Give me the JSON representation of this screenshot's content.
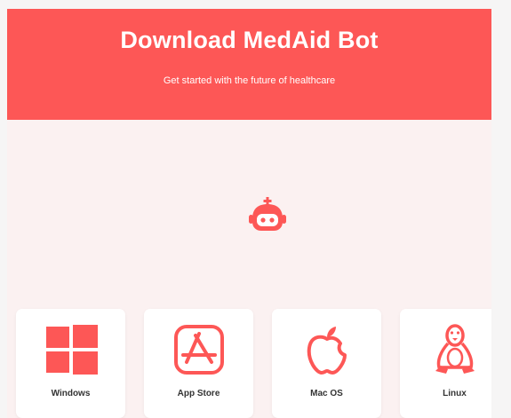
{
  "header": {
    "title": "Download MedAid Bot",
    "subtitle": "Get started with the future of healthcare"
  },
  "logo": {
    "icon": "medical-bot-icon"
  },
  "platforms": [
    {
      "label": "Windows",
      "icon": "windows-icon"
    },
    {
      "label": "App Store",
      "icon": "app-store-icon"
    },
    {
      "label": "Mac OS",
      "icon": "apple-icon"
    },
    {
      "label": "Linux",
      "icon": "linux-icon"
    }
  ],
  "colors": {
    "brand": "#fd5756",
    "background": "#fbf1f1",
    "card": "#ffffff"
  }
}
